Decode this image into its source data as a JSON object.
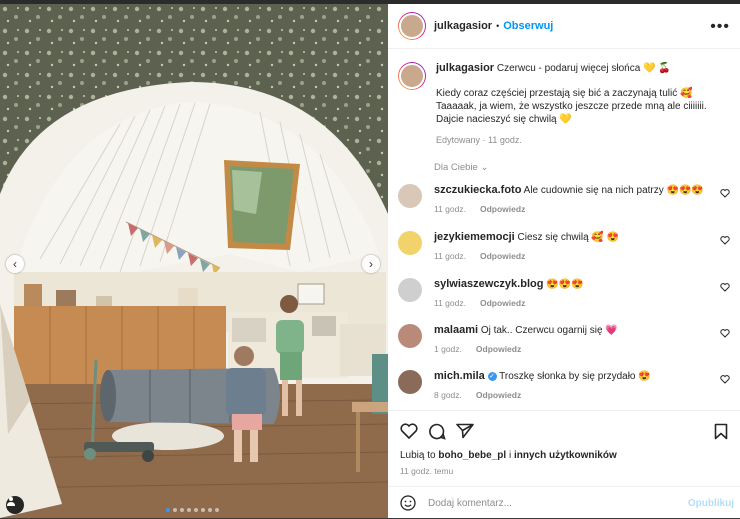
{
  "post": {
    "username": "julkagasior",
    "follow_label": "Obserwuj",
    "separator": "•",
    "caption_line1": "Czerwcu - podaruj więcej słońca 💛 🍒",
    "caption_line2": "Kiedy coraz częściej przestają się bić a zaczynają tulić 🥰",
    "caption_line3": "Taaaaak, ja wiem, że wszystko jeszcze przede mną ale ciiiiiii. Dajcie nacieszyć się chwilą 💛",
    "caption_meta": "Edytowany · 11 godz.",
    "sort_label": "Dla Ciebie",
    "likes_prefix": "Lubią to ",
    "likes_user": "boho_bebe_pl",
    "likes_suffix": " i ",
    "likes_others": "innych użytkowników",
    "time_ago": "11 godz. temu",
    "add_comment_placeholder": "Dodaj komentarz...",
    "publish_label": "Opublikuj",
    "reply_label": "Odpowiedz"
  },
  "comments": [
    {
      "user": "szczukiecka.foto",
      "text": "Ale cudownie się na nich patrzy 😍😍😍",
      "time": "11 godz.",
      "reply": "Odpowiedz",
      "avatar_color": "#d9c7b8"
    },
    {
      "user": "jezykiememocji",
      "text": "Ciesz się chwilą 🥰 😍",
      "time": "11 godz.",
      "reply": "Odpowiedz",
      "avatar_color": "#f2d36b"
    },
    {
      "user": "sylwiaszewczyk.blog",
      "text": "😍😍😍",
      "time": "11 godz.",
      "reply": "Odpowiedz",
      "avatar_color": "#cfcfcf"
    },
    {
      "user": "malaami",
      "text": "Oj tak.. Czerwcu ogarnij się 💗",
      "time": "1 godz.",
      "reply": "Odpowiedz",
      "avatar_color": "#b98a7a"
    },
    {
      "user": "mich.mila",
      "text": "Troszkę słonka by się przydało 😍",
      "time": "8 godz.",
      "reply": "Odpowiedz",
      "avatar_color": "#8a6a58"
    }
  ],
  "carousel": {
    "total": 8,
    "active": 1
  },
  "icons": {
    "prev": "chevron-left-icon",
    "next": "chevron-right-icon",
    "like": "heart-icon",
    "comment": "comment-icon",
    "share": "send-icon",
    "save": "bookmark-icon",
    "emoji": "smiley-icon",
    "more": "more-icon",
    "tag": "user-tag-icon"
  },
  "colors": {
    "follow": "#0095f6",
    "publish_disabled": "#b2dffc",
    "verified": "#3897f0"
  }
}
